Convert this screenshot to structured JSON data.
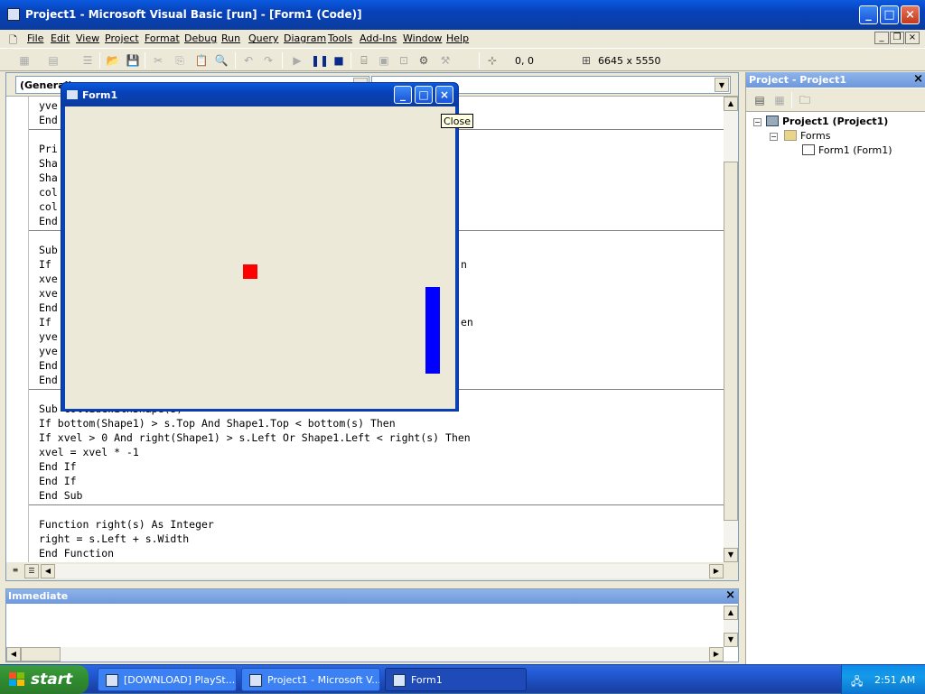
{
  "app": {
    "title": "Project1 - Microsoft Visual Basic [run] - [Form1 (Code)]"
  },
  "menu": [
    "File",
    "Edit",
    "View",
    "Project",
    "Format",
    "Debug",
    "Run",
    "Query",
    "Diagram",
    "Tools",
    "Add-Ins",
    "Window",
    "Help"
  ],
  "toolbar": {
    "position": "0, 0",
    "size": "6645 x 5550"
  },
  "code": {
    "object_combo": "(General)",
    "proc_combo": "",
    "lines": [
      "yve",
      "End",
      "",
      "Pri",
      "Sha",
      "Sha",
      "col",
      "col",
      "End",
      "",
      "Sub",
      "If",
      "xve",
      "xve",
      "End",
      "If",
      "yve",
      "yve",
      "End",
      "End",
      "",
      "Sub CollideWithShape(s)",
      "If bottom(Shape1) > s.Top And Shape1.Top < bottom(s) Then",
      "If xvel > 0 And right(Shape1) > s.Left Or Shape1.Left < right(s) Then",
      "xvel = xvel * -1",
      "End If",
      "End If",
      "End Sub",
      "",
      "Function right(s) As Integer",
      "right = s.Left + s.Width",
      "End Function"
    ],
    "hidden_right_fragments": [
      "n",
      "en"
    ]
  },
  "project_explorer": {
    "title": "Project - Project1",
    "root": "Project1 (Project1)",
    "folder": "Forms",
    "item": "Form1 (Form1)"
  },
  "immediate": {
    "title": "Immediate"
  },
  "form1": {
    "title": "Form1",
    "tooltip": "Close",
    "ball_color": "#ff0000",
    "paddle_color": "#0000ff"
  },
  "taskbar": {
    "start": "start",
    "tasks": [
      "[DOWNLOAD] PlaySt...",
      "Project1 - Microsoft V...",
      "Form1"
    ],
    "clock": "2:51 AM"
  }
}
